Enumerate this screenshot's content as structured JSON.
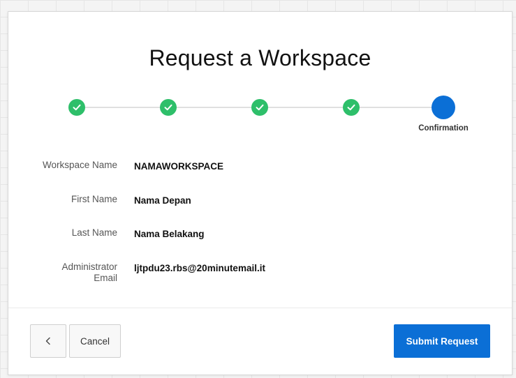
{
  "dialog": {
    "title": "Request a Workspace"
  },
  "wizard": {
    "steps": [
      {
        "state": "complete",
        "label": ""
      },
      {
        "state": "complete",
        "label": ""
      },
      {
        "state": "complete",
        "label": ""
      },
      {
        "state": "complete",
        "label": ""
      },
      {
        "state": "current",
        "label": "Confirmation"
      }
    ],
    "complete_color": "#2ebf6a",
    "current_color": "#0b6fd6"
  },
  "fields": [
    {
      "label": "Workspace Name",
      "value": "NAMAWORKSPACE"
    },
    {
      "label": "First Name",
      "value": "Nama Depan"
    },
    {
      "label": "Last Name",
      "value": "Nama Belakang"
    },
    {
      "label_line1": "Administrator",
      "label_line2": "Email",
      "value": "ljtpdu23.rbs@20minutemail.it"
    }
  ],
  "footer": {
    "back_icon": "chevron-left-icon",
    "cancel_label": "Cancel",
    "submit_label": "Submit Request",
    "submit_color": "#0b6fd6"
  }
}
